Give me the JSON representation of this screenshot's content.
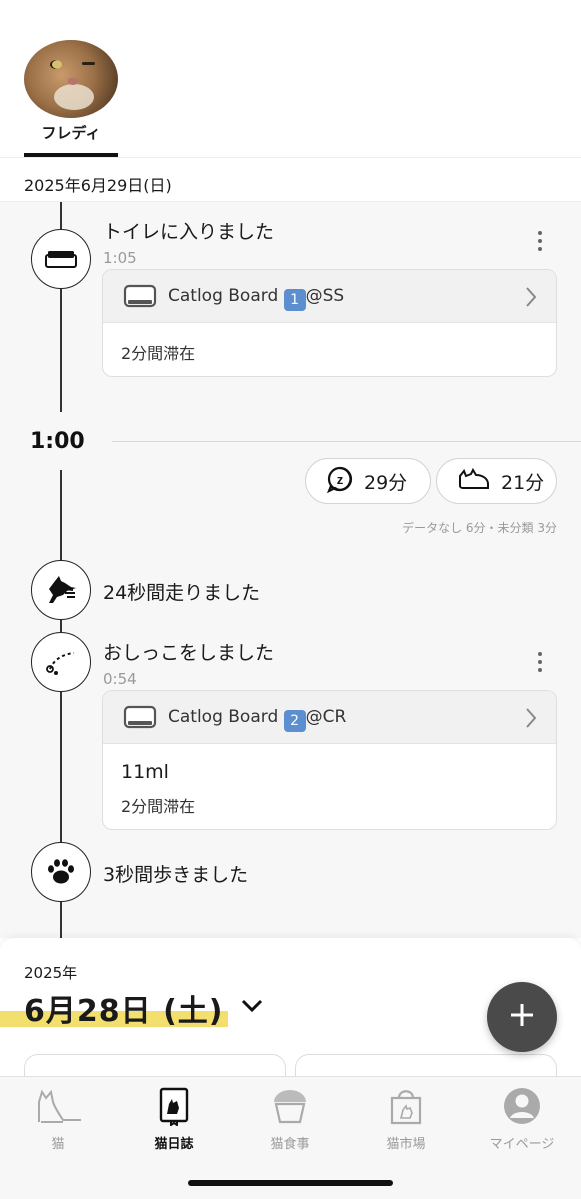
{
  "header": {
    "cat_name": "フレディ",
    "date": "2025年6月29日(日)"
  },
  "timeline": {
    "events": [
      {
        "icon": "litter-box-icon",
        "title": "トイレに入りました",
        "time": "1:05",
        "card": {
          "device": "Catlog Board",
          "badge": "1",
          "owner": "@SS",
          "lines": [
            "2分間滞在"
          ]
        }
      },
      {
        "icon": "running-cat-icon",
        "title": "24秒間走りました"
      },
      {
        "icon": "urine-icon",
        "title": "おしっこをしました",
        "time": "0:54",
        "card": {
          "device": "Catlog Board",
          "badge": "2",
          "owner": "@CR",
          "lines": [
            "11ml",
            "2分間滞在"
          ]
        }
      },
      {
        "icon": "paw-icon",
        "title": "3秒間歩きました"
      }
    ],
    "hour_marker": "1:00",
    "summary": {
      "sleep": "29分",
      "rest": "21分",
      "note": "データなし 6分・未分類 3分"
    }
  },
  "next_day": {
    "year": "2025年",
    "date": "6月28日 (土)"
  },
  "tabs": [
    {
      "label": "猫",
      "icon": "cat-icon",
      "active": false
    },
    {
      "label": "猫日誌",
      "icon": "cat-diary-icon",
      "active": true
    },
    {
      "label": "猫食事",
      "icon": "food-bowl-icon",
      "active": false
    },
    {
      "label": "猫市場",
      "icon": "shopping-bag-icon",
      "active": false
    },
    {
      "label": "マイページ",
      "icon": "user-icon",
      "active": false
    }
  ],
  "colors": {
    "accent_highlight": "#f3df6e",
    "fab": "#4a4a4a",
    "badge_blue": "#5b8fd0"
  }
}
